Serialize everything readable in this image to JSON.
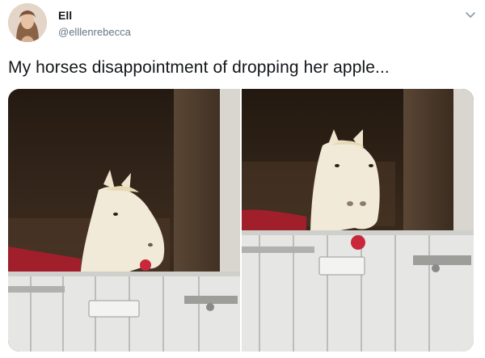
{
  "user": {
    "display_name": "Ell",
    "handle": "@elllenrebecca"
  },
  "tweet": {
    "text": "My horses disappointment of dropping her apple..."
  },
  "icons": {
    "menu": "chevron-down-icon"
  },
  "colors": {
    "text_primary": "#14171a",
    "text_secondary": "#657786",
    "door_white": "#e6e6e6",
    "stable_dark": "#3b2a1c",
    "apple_red": "#c8283a"
  }
}
